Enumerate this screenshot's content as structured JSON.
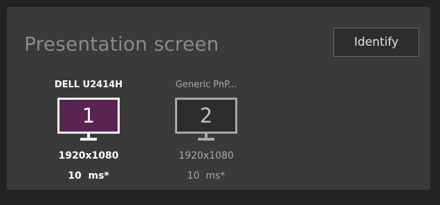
{
  "panel": {
    "title": "Presentation screen",
    "identify_label": "Identify"
  },
  "monitors": [
    {
      "name": "DELL U2414H",
      "number": "1",
      "resolution": "1920x1080",
      "latency": "10  ms*",
      "selected": true
    },
    {
      "name": "Generic PnP...",
      "number": "2",
      "resolution": "1920x1080",
      "latency": "10  ms*",
      "selected": false
    }
  ],
  "colors": {
    "background": "#232323",
    "panel": "#3a3a3a",
    "selected_screen": "#5a2450",
    "inactive_screen": "#2c2c2c"
  }
}
